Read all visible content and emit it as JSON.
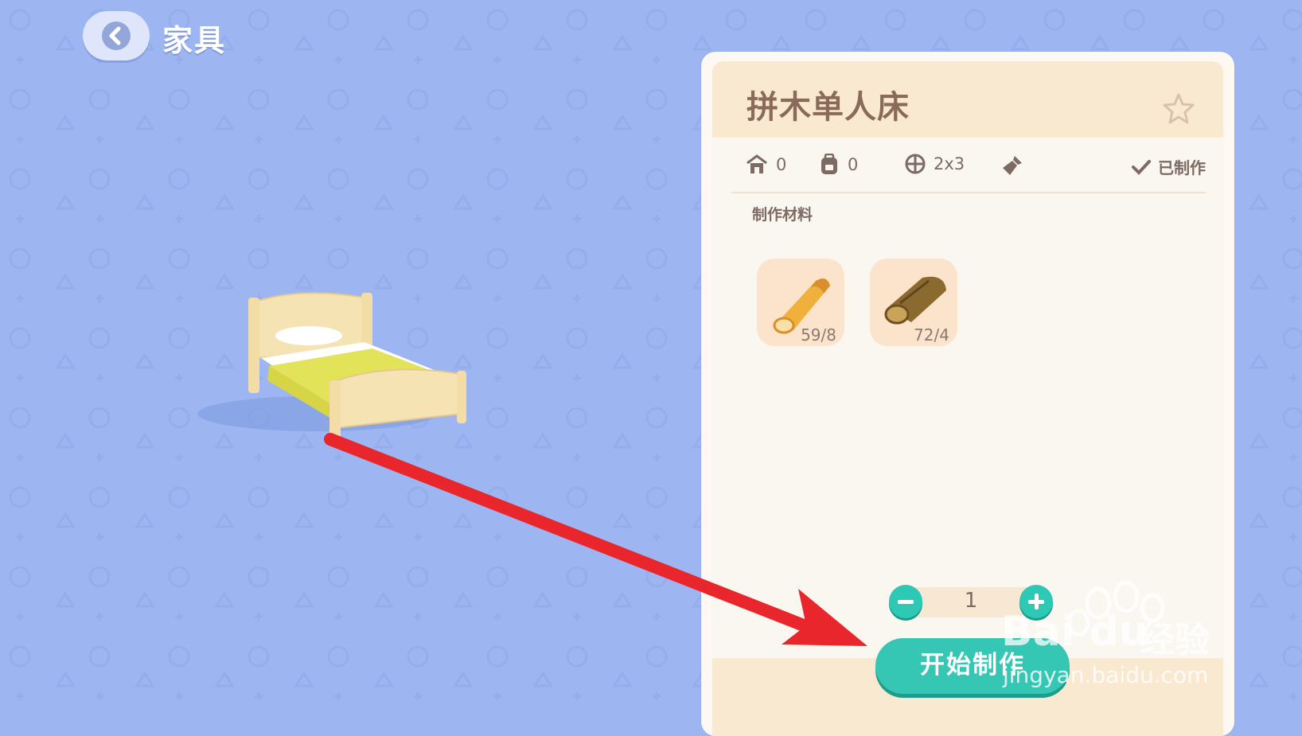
{
  "header": {
    "title": "家具",
    "back_icon": "chevron-left-icon"
  },
  "item": {
    "name": "拼木单人床",
    "favorite_icon": "star-outline-icon",
    "stats": {
      "comfort": {
        "icon": "house-icon",
        "value": "0"
      },
      "storage": {
        "icon": "backpack-icon",
        "value": "0"
      },
      "size": {
        "icon": "grid-icon",
        "value": "2x3"
      },
      "dye_icon": "paintbrush-icon",
      "crafted": {
        "icon": "check-icon",
        "label": "已制作"
      }
    },
    "materials_title": "制作材料",
    "materials": [
      {
        "icon": "light-wood-log-icon",
        "count": "59/8"
      },
      {
        "icon": "dark-wood-log-icon",
        "count": "72/4"
      }
    ]
  },
  "quantity": {
    "value": "1"
  },
  "craft_button": {
    "label": "开始制作"
  },
  "watermark": {
    "brand": "Bai du",
    "cn": "经验",
    "url": "jingyan.baidu.com"
  },
  "colors": {
    "background": "#9db6f2",
    "accent": "#35c7b4",
    "panel_header": "#fae9d1",
    "arrow": "#e8262b"
  }
}
